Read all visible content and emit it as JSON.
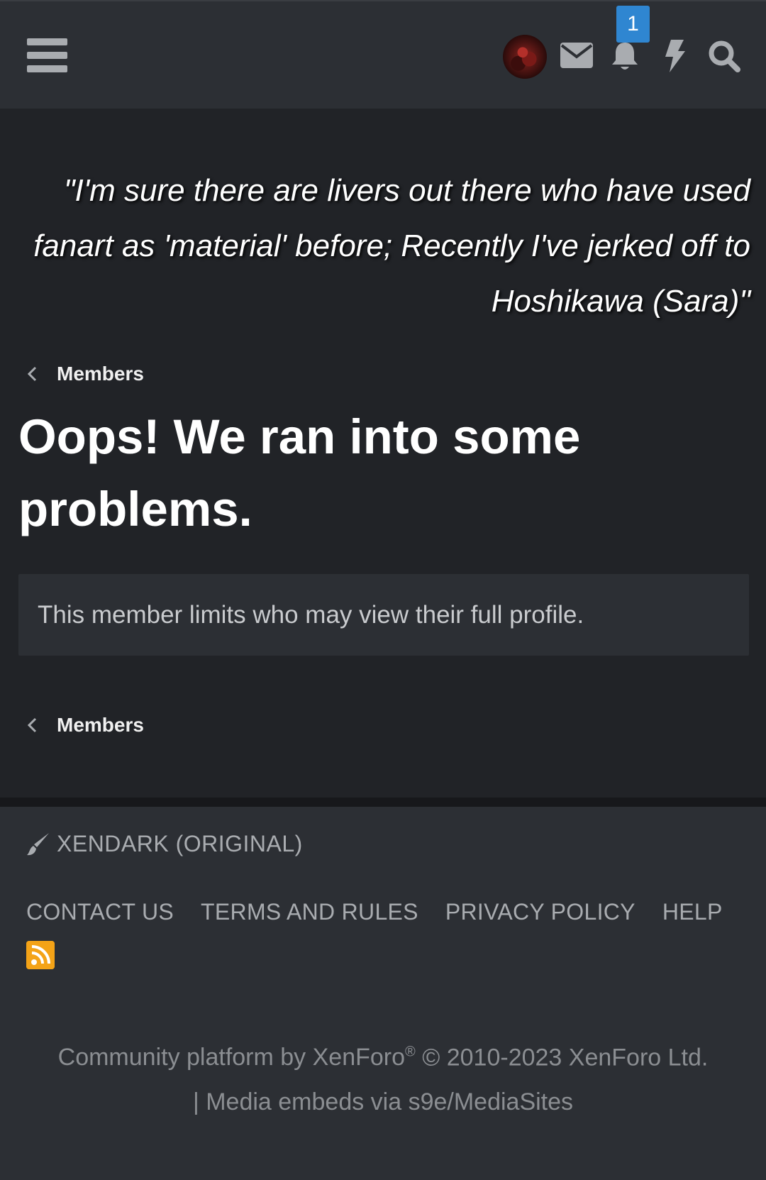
{
  "header": {
    "notification_count": "1",
    "icons": [
      "menu-icon",
      "avatar",
      "mail-icon",
      "bell-icon",
      "bolt-icon",
      "search-icon"
    ]
  },
  "banner": {
    "quote": "\"I'm sure there are livers out there who have used fanart as 'material' before; Recently I've jerked off to Hoshikawa (Sara)\""
  },
  "breadcrumb": {
    "label": "Members"
  },
  "main": {
    "title": "Oops! We ran into some problems.",
    "notice": "This member limits who may view their full profile."
  },
  "footer": {
    "style_name": "XENDARK (ORIGINAL)",
    "links": [
      "CONTACT US",
      "TERMS AND RULES",
      "PRIVACY POLICY",
      "HELP"
    ],
    "copyright_line1": "Community platform by XenForo",
    "registered": "®",
    "copyright_line1b": " © 2010-2023 XenForo Ltd.",
    "copyright_line2": "| Media embeds via s9e/MediaSites"
  },
  "colors": {
    "page_bg": "#212327",
    "bar_bg": "#2c2f34",
    "badge": "#2f86d1",
    "rss": "#f4a317"
  }
}
